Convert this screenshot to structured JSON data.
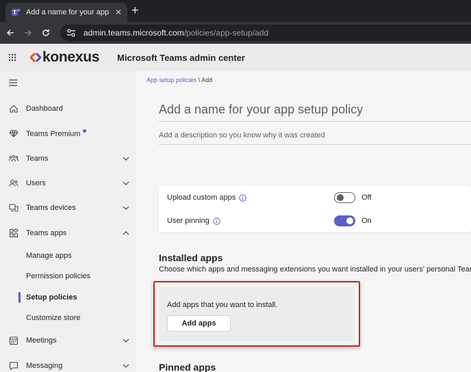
{
  "browser": {
    "tab_title": "Add a name for your app setup policy",
    "new_tab_symbol": "+",
    "close_symbol": "✕",
    "url_host": "admin.teams.microsoft.com",
    "url_path": "/policies/app-setup/add"
  },
  "header": {
    "logo_text": "konexus",
    "app_name": "Microsoft Teams admin center"
  },
  "sidebar": {
    "items": [
      {
        "label": "Dashboard",
        "icon": "home-icon"
      },
      {
        "label": "Teams Premium",
        "icon": "diamond-icon"
      },
      {
        "label": "Teams",
        "icon": "teams-icon"
      },
      {
        "label": "Users",
        "icon": "users-icon"
      },
      {
        "label": "Teams devices",
        "icon": "devices-icon"
      },
      {
        "label": "Teams apps",
        "icon": "apps-icon"
      },
      {
        "label": "Meetings",
        "icon": "calendar-icon"
      },
      {
        "label": "Messaging",
        "icon": "chat-icon"
      }
    ],
    "subitems": [
      {
        "label": "Manage apps"
      },
      {
        "label": "Permission policies"
      },
      {
        "label": "Setup policies",
        "active": true
      },
      {
        "label": "Customize store"
      }
    ]
  },
  "main": {
    "breadcrumb_parent": "App setup policies",
    "breadcrumb_separator": "\\",
    "breadcrumb_current": "Add",
    "name_placeholder": "Add a name for your app setup policy",
    "description_placeholder": "Add a description so you know why it was created",
    "settings": [
      {
        "label": "Upload custom apps",
        "state": "Off",
        "on": false
      },
      {
        "label": "User pinning",
        "state": "On",
        "on": true
      }
    ],
    "installed_apps": {
      "title": "Installed apps",
      "description": "Choose which apps and messaging extensions you want installed in your users' personal Teams env",
      "card_text": "Add apps that you want to install.",
      "button_label": "Add apps"
    },
    "pinned_apps": {
      "title": "Pinned apps"
    }
  },
  "colors": {
    "accent": "#5b5fc7",
    "highlight": "#c42b1c"
  }
}
